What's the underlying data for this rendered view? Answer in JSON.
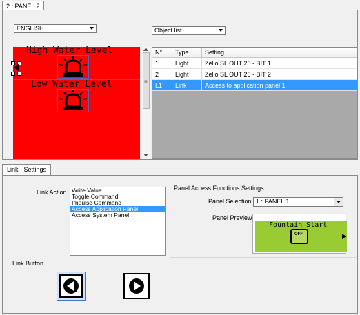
{
  "top_tab": "2 : PANEL 2",
  "language_select": "ENGLISH",
  "object_list_select": "Object list",
  "panel_texts": {
    "line1": "High Water Level",
    "line2": "Low Water Level"
  },
  "table": {
    "headers": [
      "N°",
      "Type",
      "Setting"
    ],
    "rows": [
      {
        "n": "1",
        "type": "Light",
        "setting": "Zelio SL OUT 25 - BIT 1"
      },
      {
        "n": "2",
        "type": "Light",
        "setting": "Zelio SL OUT 25 - BIT 2"
      },
      {
        "n": "L1",
        "type": "Link",
        "setting": "Access to application panel 1"
      }
    ],
    "selected_row": 2
  },
  "bottom_tab": "Link - Settings",
  "link_action": {
    "label": "Link Action",
    "items": [
      "Write Value",
      "Toggle Command",
      "Impulse Command",
      "Access Application Panel",
      "Access System Panel"
    ],
    "selected": 3
  },
  "panel_access": {
    "group_title": "Panel Access Functions Settings",
    "selection_label": "Panel Selection",
    "selection_value": "1 : PANEL 1",
    "preview_label": "Panel Preview",
    "preview_text": "Fountain Start",
    "preview_button": "OFF"
  },
  "link_button": {
    "label": "Link Button"
  },
  "colors": {
    "red": "#ff0000",
    "lcd_green": "#99cc33",
    "selection_blue": "#3399ff"
  }
}
